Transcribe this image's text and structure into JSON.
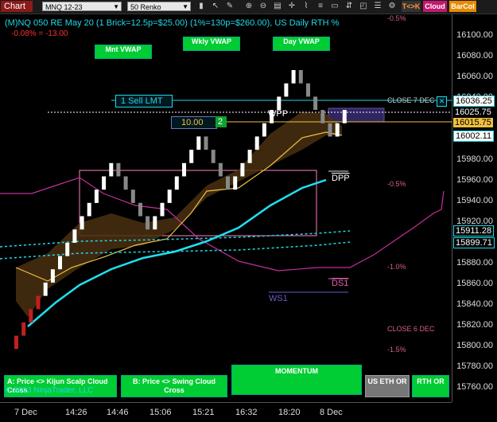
{
  "toolbar": {
    "chart_label": "Chart",
    "instrument": "MNQ 12-23",
    "interval": "50 Renko",
    "btn_tk": "T<>K",
    "btn_cloud": "Cloud",
    "btn_barcol": "BarCol"
  },
  "header": {
    "title": "(M)NQ 050 RE May 20 (1 Brick=12.5p=$25.00) (1%=130p=$260.00), US Daily RTH %",
    "change": "-0.08% = -13.00",
    "top_right_pct": "-0.5%"
  },
  "vwap_buttons": {
    "monthly": "Mnt VWAP",
    "weekly": "Wkly VWAP",
    "daily": "Day VWAP"
  },
  "order": {
    "sell_label": "1 Sell LMT",
    "price_box": "10.00",
    "qty": "2"
  },
  "chart_labels": {
    "close7": "CLOSE 7 DEC",
    "close6": "CLOSE 6 DEC",
    "wpp": "WPP",
    "dpp": "DPP",
    "ds1": "DS1",
    "ws1": "WS1",
    "pct_m05": "-0.5%",
    "pct_m10": "-1.0%",
    "pct_m15": "-1.5%",
    "copyright": "© 2023 NinjaTrader, LLC"
  },
  "price_axis": {
    "labels": [
      "16100.00",
      "16080.00",
      "16060.00",
      "16040.00",
      "15980.00",
      "15960.00",
      "15940.00",
      "15920.00",
      "15880.00",
      "15860.00",
      "15840.00",
      "15820.00",
      "15800.00",
      "15780.00",
      "15760.00"
    ],
    "tags": [
      {
        "text": "16036.25",
        "color": "#00d8e8"
      },
      {
        "text": "16025.75",
        "color": "#ffffff"
      },
      {
        "text": "16015.75",
        "color": "#f0c040"
      },
      {
        "text": "16002.11",
        "color": "#00d8e8"
      },
      {
        "text": "15911.28",
        "color": "#00d8e8"
      },
      {
        "text": "15899.71",
        "color": "#00d8e8"
      }
    ]
  },
  "time_axis": {
    "labels": [
      "7 Dec",
      "14:26",
      "14:46",
      "15:06",
      "15:21",
      "16:32",
      "18:20",
      "8 Dec"
    ]
  },
  "bottom_buttons": {
    "a_cross": "A: Price <> Kijun Scalp Cloud Cross",
    "b_cross": "B: Price <> Swing Cloud Cross",
    "momentum": "MOMENTUM",
    "us_eth": "US ETH OR",
    "rth": "RTH OR"
  },
  "chart_data": {
    "type": "candlestick",
    "instrument": "MNQ 12-23",
    "bricks": [
      15812.5,
      15825,
      15837.5,
      15850,
      15862.5,
      15875,
      15887.5,
      15900,
      15912.5,
      15925,
      15937.5,
      15950,
      15962.5,
      15975,
      15962.5,
      15950,
      15937.5,
      15925,
      15912.5,
      15925,
      15937.5,
      15950,
      15962.5,
      15975,
      15987.5,
      16000,
      15987.5,
      15975,
      15962.5,
      15950,
      15962.5,
      15975,
      15987.5,
      16000,
      16012.5,
      16025,
      16037.5,
      16050,
      16062.5,
      16050,
      16037.5,
      16025,
      16012.5,
      16000,
      16012.5,
      16025
    ],
    "ylim": [
      15750,
      16115
    ]
  }
}
